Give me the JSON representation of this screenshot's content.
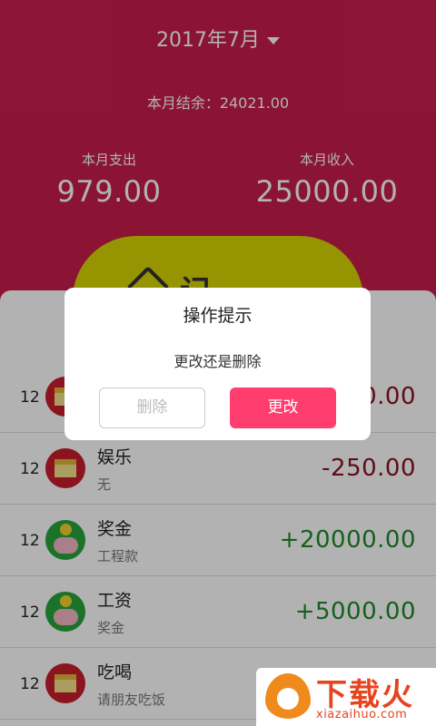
{
  "header": {
    "month": "2017年7月",
    "balance": "本月结余：24021.00",
    "expense_label": "本月支出",
    "expense_value": "979.00",
    "income_label": "本月收入",
    "income_value": "25000.00",
    "record_label": "记一笔",
    "bg_color": "#c81e4c"
  },
  "list": {
    "rows": [
      {
        "day": "12",
        "icon": "box-icon",
        "name": "",
        "note": "",
        "amount": "0.00"
      },
      {
        "day": "12",
        "icon": "box-icon",
        "name": "娱乐",
        "note": "无",
        "amount": "-250.00"
      },
      {
        "day": "12",
        "icon": "piggy-bank-icon",
        "name": "奖金",
        "note": "工程款",
        "amount": "+20000.00"
      },
      {
        "day": "12",
        "icon": "piggy-bank-icon",
        "name": "工资",
        "note": "奖金",
        "amount": "+5000.00"
      },
      {
        "day": "12",
        "icon": "box-icon",
        "name": "吃喝",
        "note": "请朋友吃饭",
        "amount": ""
      }
    ]
  },
  "dialog": {
    "title": "操作提示",
    "message": "更改还是删除",
    "delete_label": "删除",
    "change_label": "更改",
    "accent_color": "#ff3d6e"
  },
  "watermark": {
    "text": "下载火",
    "site": "xiazaihuo.com"
  }
}
